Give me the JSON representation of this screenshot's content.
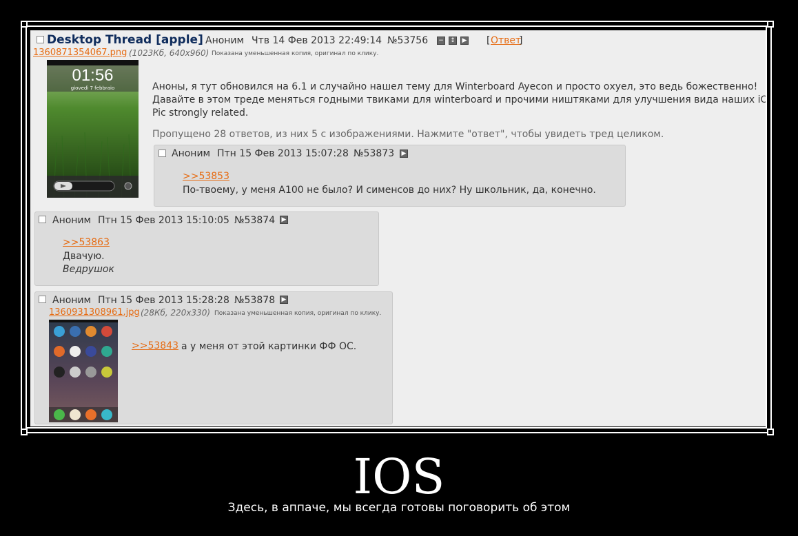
{
  "op": {
    "title": "Desktop Thread [apple]",
    "author": "Аноним",
    "date": "Чтв 14 Фев 2013 22:49:14",
    "number": "№53756",
    "reply_link": "Ответ",
    "reply_open": "[",
    "reply_close": "]",
    "file_name": "1360871354067.png",
    "file_info": "(1023Кб, 640x960)",
    "file_note": "Показана уменьшенная копия, оригинал по клику.",
    "thumb_time": "01:56",
    "thumb_date": "giovedì 7 febbraio",
    "body": [
      "Аноны, я тут обновился на 6.1 и случайно нашел тему для Winterboard Ayecon и просто охуел, это ведь божественно!",
      "Давайте в этом треде меняться годными твиками для winterboard и прочими ништяками для улучшения вида наших iOS.",
      "Pic strongly related."
    ],
    "omitted": "Пропущено 28 ответов, из них 5 с изображениями. Нажмите \"ответ\", чтобы увидеть тред целиком."
  },
  "replies": [
    {
      "author": "Аноним",
      "date": "Птн 15 Фев 2013 15:07:28",
      "number": "№53873",
      "quote": ">>53853",
      "text": "По-твоему, у меня A100 не было? И сименсов до них? Ну школьник, да, конечно."
    },
    {
      "author": "Аноним",
      "date": "Птн 15 Фев 2013 15:10:05",
      "number": "№53874",
      "quote": ">>53863",
      "text": "Двачую.",
      "signature": "Ведрушок"
    },
    {
      "author": "Аноним",
      "date": "Птн 15 Фев 2013 15:28:28",
      "number": "№53878",
      "file_name": "1360931308961.jpg",
      "file_info": "(28Кб, 220x330)",
      "file_note": "Показана уменьшенная копия, оригинал по клику.",
      "quote": ">>53843",
      "text": "а у меня от этой картинки ФФ ОС."
    }
  ],
  "caption": {
    "title": "IOS",
    "subtitle": "Здесь, в аппаче, мы всегда готовы поговорить об этом"
  },
  "colors": {
    "background": "#000000",
    "board": "#eeeeee",
    "post": "#dcdcdc",
    "link": "#e66b12",
    "title": "#0f2c5c"
  }
}
